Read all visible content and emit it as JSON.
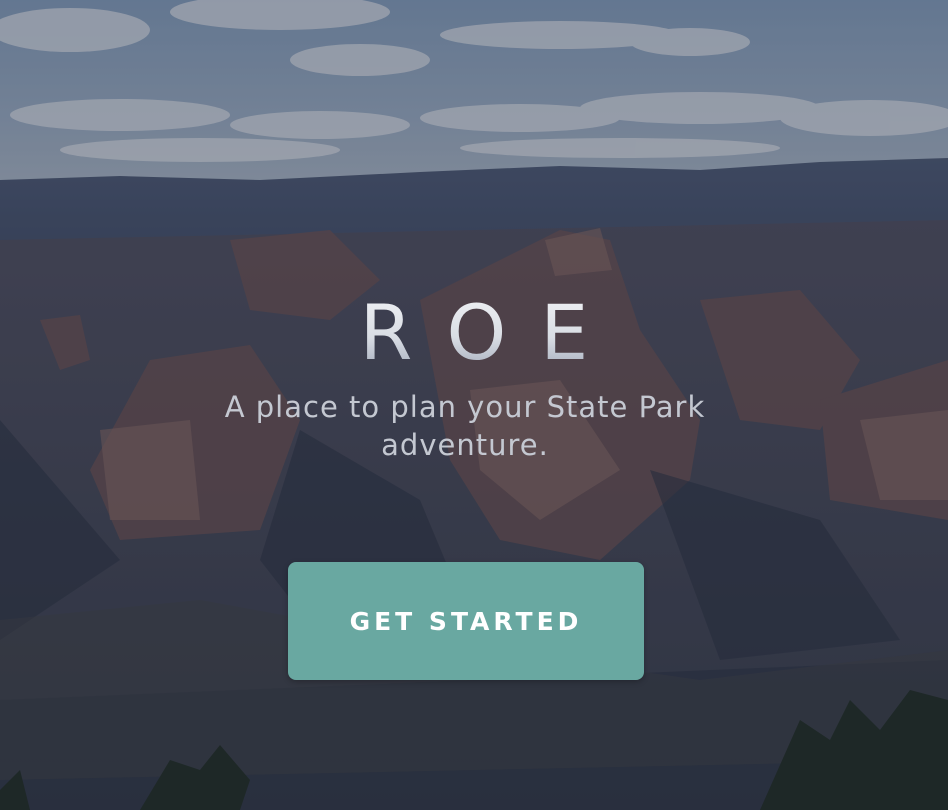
{
  "hero": {
    "background_icon": "canyon-landscape-photo",
    "brand": "ROE",
    "tagline": "A place to plan your State Park adventure.",
    "cta_label": "GET STARTED"
  },
  "colors": {
    "cta_background": "#69a8a1",
    "cta_text": "#ffffff",
    "tagline_text": "#c4c8d1"
  }
}
